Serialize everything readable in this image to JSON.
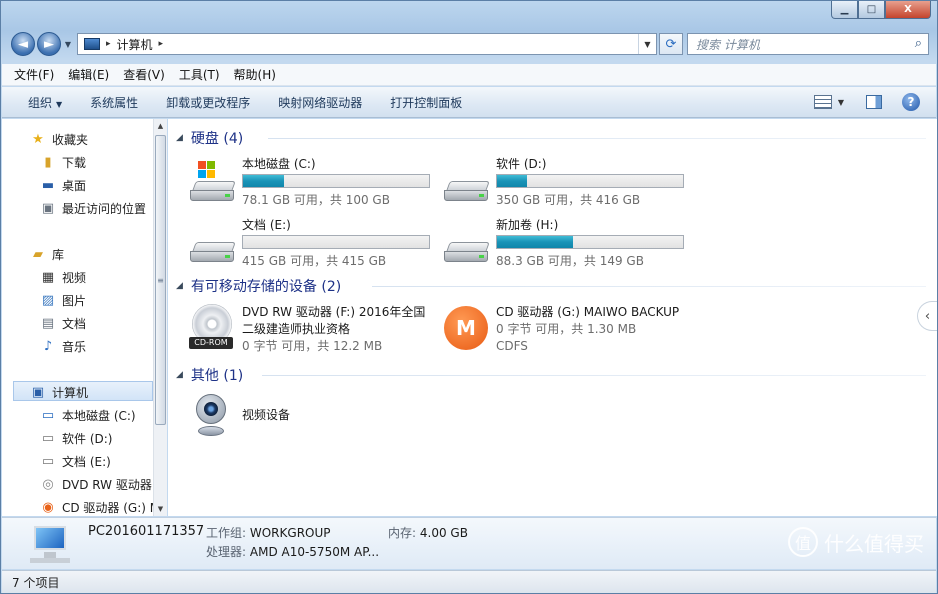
{
  "window": {
    "min": "▁",
    "max": "□",
    "close": "X"
  },
  "nav": {
    "back": "◄",
    "forward": "►",
    "address": {
      "root_sep": "▸",
      "crumb": "计算机",
      "crumb_sep": "▸"
    },
    "search_placeholder": "搜索 计算机"
  },
  "menu": [
    "文件(F)",
    "编辑(E)",
    "查看(V)",
    "工具(T)",
    "帮助(H)"
  ],
  "toolbar": {
    "organize": "组织",
    "items": [
      "系统属性",
      "卸载或更改程序",
      "映射网络驱动器",
      "打开控制面板"
    ]
  },
  "sidebar": {
    "favorites": {
      "label": "收藏夹",
      "items": [
        "下载",
        "桌面",
        "最近访问的位置"
      ]
    },
    "libraries": {
      "label": "库",
      "items": [
        "视频",
        "图片",
        "文档",
        "音乐"
      ]
    },
    "computer": {
      "label": "计算机",
      "items": [
        "本地磁盘 (C:)",
        "软件 (D:)",
        "文档 (E:)",
        "DVD RW 驱动器",
        "CD 驱动器 (G:) M"
      ]
    }
  },
  "groups": {
    "hdd": "硬盘 (4)",
    "removable": "有可移动存储的设备 (2)",
    "other": "其他 (1)"
  },
  "drives": [
    {
      "name": "本地磁盘 (C:)",
      "free": "78.1 GB 可用，共 100 GB",
      "used_fraction": 0.219
    },
    {
      "name": "软件 (D:)",
      "free": "350 GB 可用，共 416 GB",
      "used_fraction": 0.159
    },
    {
      "name": "文档 (E:)",
      "free": "415 GB 可用，共 415 GB",
      "used_fraction": 0.0
    },
    {
      "name": "新加卷 (H:)",
      "free": "88.3 GB 可用，共 149 GB",
      "used_fraction": 0.407
    }
  ],
  "removable": [
    {
      "line1": "DVD RW 驱动器 (F:) 2016年全国",
      "line2": "二级建造师执业资格",
      "line3": "0 字节 可用，共 12.2 MB",
      "badge": "CD-ROM"
    },
    {
      "line1": "CD 驱动器 (G:) MAIWO BACKUP",
      "line2": "0 字节 可用，共 1.30 MB",
      "line3": "CDFS",
      "badge": "M"
    }
  ],
  "other": [
    {
      "name": "视频设备"
    }
  ],
  "details": {
    "pc_name": "PC201601171357",
    "workgroup_label": "工作组:",
    "workgroup": "WORKGROUP",
    "memory_label": "内存:",
    "memory": "4.00 GB",
    "cpu_label": "处理器:",
    "cpu": "AMD A10-5750M AP..."
  },
  "status": "7 个项目",
  "watermark": {
    "icon": "值",
    "text": "什么值得买"
  }
}
